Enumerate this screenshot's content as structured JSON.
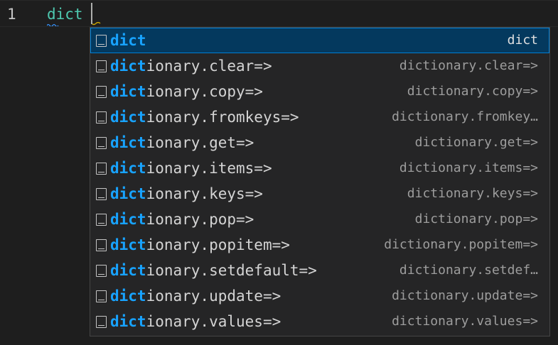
{
  "editor": {
    "line_number": "1",
    "code": "dict"
  },
  "suggestions": [
    {
      "match": "dict",
      "rest": "",
      "detail": "dict",
      "selected": true
    },
    {
      "match": "dict",
      "rest": "ionary.clear=>",
      "detail": "dictionary.clear=>"
    },
    {
      "match": "dict",
      "rest": "ionary.copy=>",
      "detail": "dictionary.copy=>"
    },
    {
      "match": "dict",
      "rest": "ionary.fromkeys=>",
      "detail": "dictionary.fromkey…"
    },
    {
      "match": "dict",
      "rest": "ionary.get=>",
      "detail": "dictionary.get=>"
    },
    {
      "match": "dict",
      "rest": "ionary.items=>",
      "detail": "dictionary.items=>"
    },
    {
      "match": "dict",
      "rest": "ionary.keys=>",
      "detail": "dictionary.keys=>"
    },
    {
      "match": "dict",
      "rest": "ionary.pop=>",
      "detail": "dictionary.pop=>"
    },
    {
      "match": "dict",
      "rest": "ionary.popitem=>",
      "detail": "dictionary.popitem=>"
    },
    {
      "match": "dict",
      "rest": "ionary.setdefault=>",
      "detail": "dictionary.setdef…"
    },
    {
      "match": "dict",
      "rest": "ionary.update=>",
      "detail": "dictionary.update=>"
    },
    {
      "match": "dict",
      "rest": "ionary.values=>",
      "detail": "dictionary.values=>"
    }
  ],
  "icons": {
    "suggestion_kind": "snippet-icon"
  },
  "colors": {
    "editor_bg": "#1e1e1e",
    "widget_bg": "#252526",
    "selected_bg": "#04395e",
    "highlight": "#18a3ff",
    "code_text": "#4ec9b0"
  }
}
